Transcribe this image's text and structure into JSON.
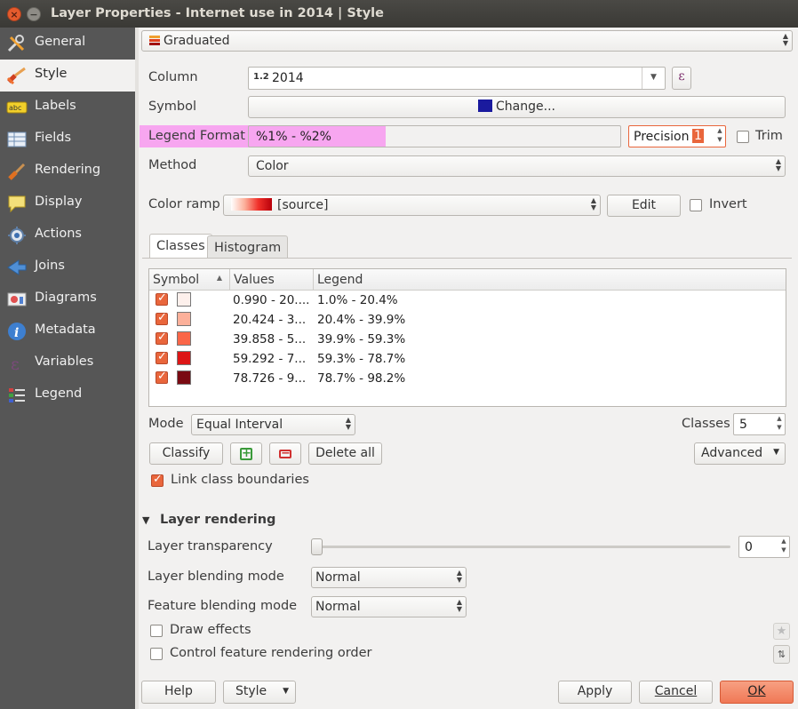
{
  "window": {
    "title": "Layer Properties - Internet use in 2014 | Style"
  },
  "sidebar": {
    "items": [
      {
        "label": "General",
        "icon": "wrench-icon"
      },
      {
        "label": "Style",
        "icon": "paintbrush-icon"
      },
      {
        "label": "Labels",
        "icon": "abc-label-icon"
      },
      {
        "label": "Fields",
        "icon": "table-icon"
      },
      {
        "label": "Rendering",
        "icon": "brush-icon"
      },
      {
        "label": "Display",
        "icon": "speech-bubble-icon"
      },
      {
        "label": "Actions",
        "icon": "gear-icon"
      },
      {
        "label": "Joins",
        "icon": "join-arrow-icon"
      },
      {
        "label": "Diagrams",
        "icon": "diagram-icon"
      },
      {
        "label": "Metadata",
        "icon": "info-icon"
      },
      {
        "label": "Variables",
        "icon": "epsilon-icon"
      },
      {
        "label": "Legend",
        "icon": "legend-icon"
      }
    ],
    "active": "Style"
  },
  "renderer": {
    "value": "Graduated"
  },
  "column": {
    "label": "Column",
    "type_badge": "1.2",
    "value": "2014",
    "expression_button": "ε"
  },
  "symbol": {
    "label": "Symbol",
    "button": "Change...",
    "color": "#1a1a9e"
  },
  "legend_format": {
    "label": "Legend Format",
    "value": "%1% - %2%",
    "precision_label": "Precision",
    "precision_value": "1",
    "trim_label": "Trim",
    "trim_checked": false
  },
  "method": {
    "label": "Method",
    "value": "Color"
  },
  "color_ramp": {
    "label": "Color ramp",
    "value": "[source]",
    "edit_button": "Edit",
    "invert_label": "Invert",
    "invert_checked": false
  },
  "tabs": [
    {
      "label": "Classes",
      "active": true
    },
    {
      "label": "Histogram",
      "active": false
    }
  ],
  "table": {
    "headers": {
      "symbol": "Symbol",
      "sort_arrow": "▲",
      "values": "Values",
      "legend": "Legend"
    },
    "rows": [
      {
        "checked": true,
        "color": "#fdf0ec",
        "values": "0.990 - 20....",
        "legend": "1.0% - 20.4%"
      },
      {
        "checked": true,
        "color": "#fcb09a",
        "values": "20.424 - 3...",
        "legend": "20.4% - 39.9%"
      },
      {
        "checked": true,
        "color": "#fa6648",
        "values": "39.858 - 5...",
        "legend": "39.9% - 59.3%"
      },
      {
        "checked": true,
        "color": "#dd1616",
        "values": "59.292 - 7...",
        "legend": "59.3% - 78.7%"
      },
      {
        "checked": true,
        "color": "#7a0a12",
        "values": "78.726 - 9...",
        "legend": "78.7% - 98.2%"
      }
    ]
  },
  "mode": {
    "label": "Mode",
    "value": "Equal Interval"
  },
  "classes": {
    "label": "Classes",
    "value": "5"
  },
  "buttons": {
    "classify": "Classify",
    "add": "+",
    "remove": "−",
    "delete_all": "Delete all",
    "advanced": "Advanced"
  },
  "link_boundaries": {
    "label": "Link class boundaries",
    "checked": true
  },
  "layer_rendering": {
    "header": "Layer rendering",
    "transparency_label": "Layer transparency",
    "transparency_value": "0",
    "layer_blend_label": "Layer blending mode",
    "layer_blend_value": "Normal",
    "feature_blend_label": "Feature blending mode",
    "feature_blend_value": "Normal",
    "draw_effects_label": "Draw effects",
    "draw_effects_checked": false,
    "render_order_label": "Control feature rendering order",
    "render_order_checked": false
  },
  "footer": {
    "help": "Help",
    "style": "Style",
    "apply": "Apply",
    "cancel": "Cancel",
    "ok": "OK"
  },
  "colors": {
    "accent": "#e9663c",
    "highlight": "#f7a6f0",
    "sidebar_bg": "#565656",
    "titlebar_bg": "#3c3b37"
  }
}
